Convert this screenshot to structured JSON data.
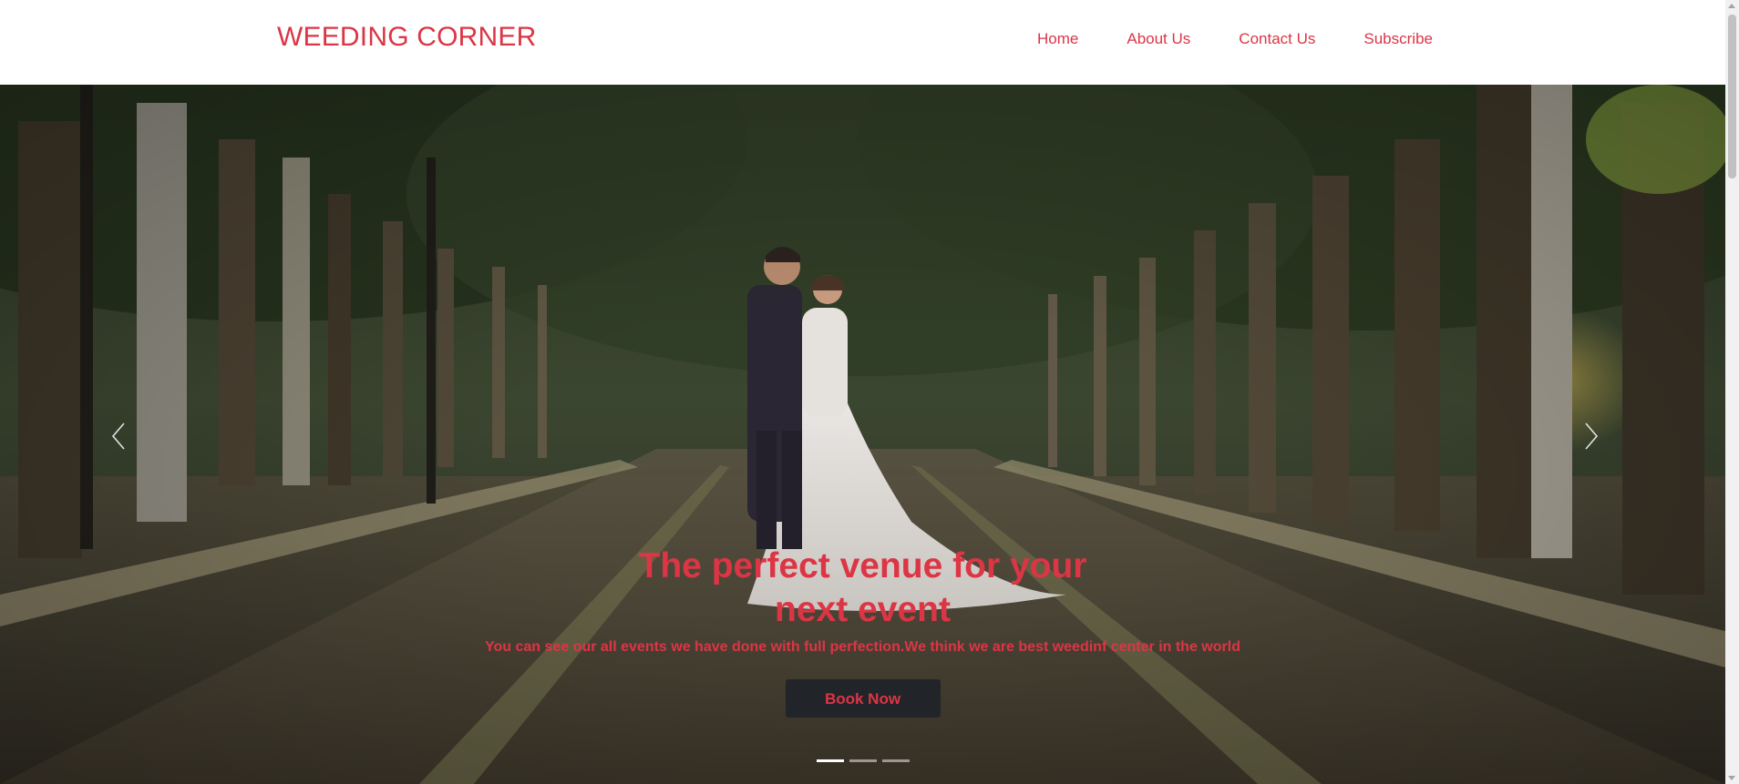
{
  "header": {
    "brand": "WEEDING CORNER",
    "nav": [
      "Home",
      "About Us",
      "Contact Us",
      "Subscribe"
    ]
  },
  "hero": {
    "title": "The perfect venue for your next event",
    "subtitle": "You can see our all events we have done with full perfection.We think we are best weedinf center in the world",
    "button_label": "Book Now",
    "slide_count": 3,
    "active_slide": 1
  },
  "icons": {
    "prev": "chevron-left-icon",
    "next": "chevron-right-icon"
  },
  "colors": {
    "accent": "#dc3545",
    "button_bg": "#212529",
    "header_bg": "#ffffff"
  }
}
